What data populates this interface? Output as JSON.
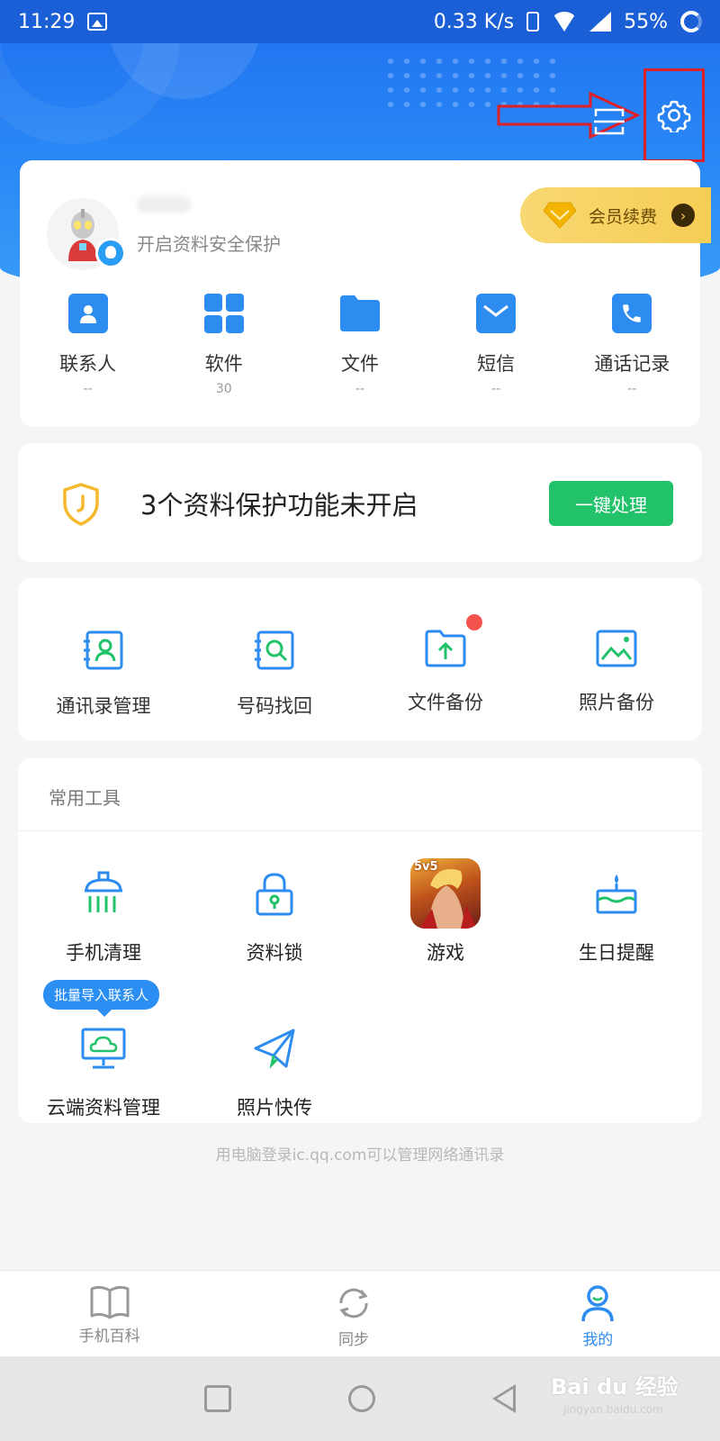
{
  "status_bar": {
    "time": "11:29",
    "network_speed": "0.33 K/s",
    "battery": "55%"
  },
  "profile": {
    "subtitle": "开启资料安全保护",
    "vip_label": "会员续费",
    "stats": [
      {
        "label": "联系人",
        "value": "--",
        "icon": "contact-icon"
      },
      {
        "label": "软件",
        "value": "30",
        "icon": "apps-icon"
      },
      {
        "label": "文件",
        "value": "--",
        "icon": "folder-icon"
      },
      {
        "label": "短信",
        "value": "--",
        "icon": "sms-icon"
      },
      {
        "label": "通话记录",
        "value": "--",
        "icon": "phone-icon"
      }
    ]
  },
  "protection": {
    "text": "3个资料保护功能未开启",
    "button": "一键处理"
  },
  "features": [
    {
      "label": "通讯录管理",
      "icon": "contacts-book-icon"
    },
    {
      "label": "号码找回",
      "icon": "number-search-icon"
    },
    {
      "label": "文件备份",
      "icon": "file-backup-icon"
    },
    {
      "label": "照片备份",
      "icon": "photo-backup-icon"
    }
  ],
  "tools": {
    "title": "常用工具",
    "items": [
      {
        "label": "手机清理",
        "icon": "phone-clean-icon"
      },
      {
        "label": "资料锁",
        "icon": "data-lock-icon"
      },
      {
        "label": "游戏",
        "icon": "game-icon",
        "badge_text": "5v5"
      },
      {
        "label": "生日提醒",
        "icon": "birthday-cake-icon"
      },
      {
        "label": "云端资料管理",
        "icon": "cloud-monitor-icon",
        "tooltip": "批量导入联系人"
      },
      {
        "label": "照片快传",
        "icon": "paper-plane-icon"
      }
    ]
  },
  "footer_note": "用电脑登录ic.qq.com可以管理网络通讯录",
  "bottom_nav": [
    {
      "label": "手机百科",
      "icon": "book-icon",
      "active": false
    },
    {
      "label": "同步",
      "icon": "sync-icon",
      "active": false
    },
    {
      "label": "我的",
      "icon": "user-icon",
      "active": true
    }
  ],
  "watermark": {
    "main": "Bai du 经验",
    "sub": "jingyan.baidu.com"
  },
  "colors": {
    "primary": "#2d8cf0",
    "green_button": "#22c26a",
    "vip_gold": "#f6cd55",
    "annotation_red": "#e01e26"
  }
}
